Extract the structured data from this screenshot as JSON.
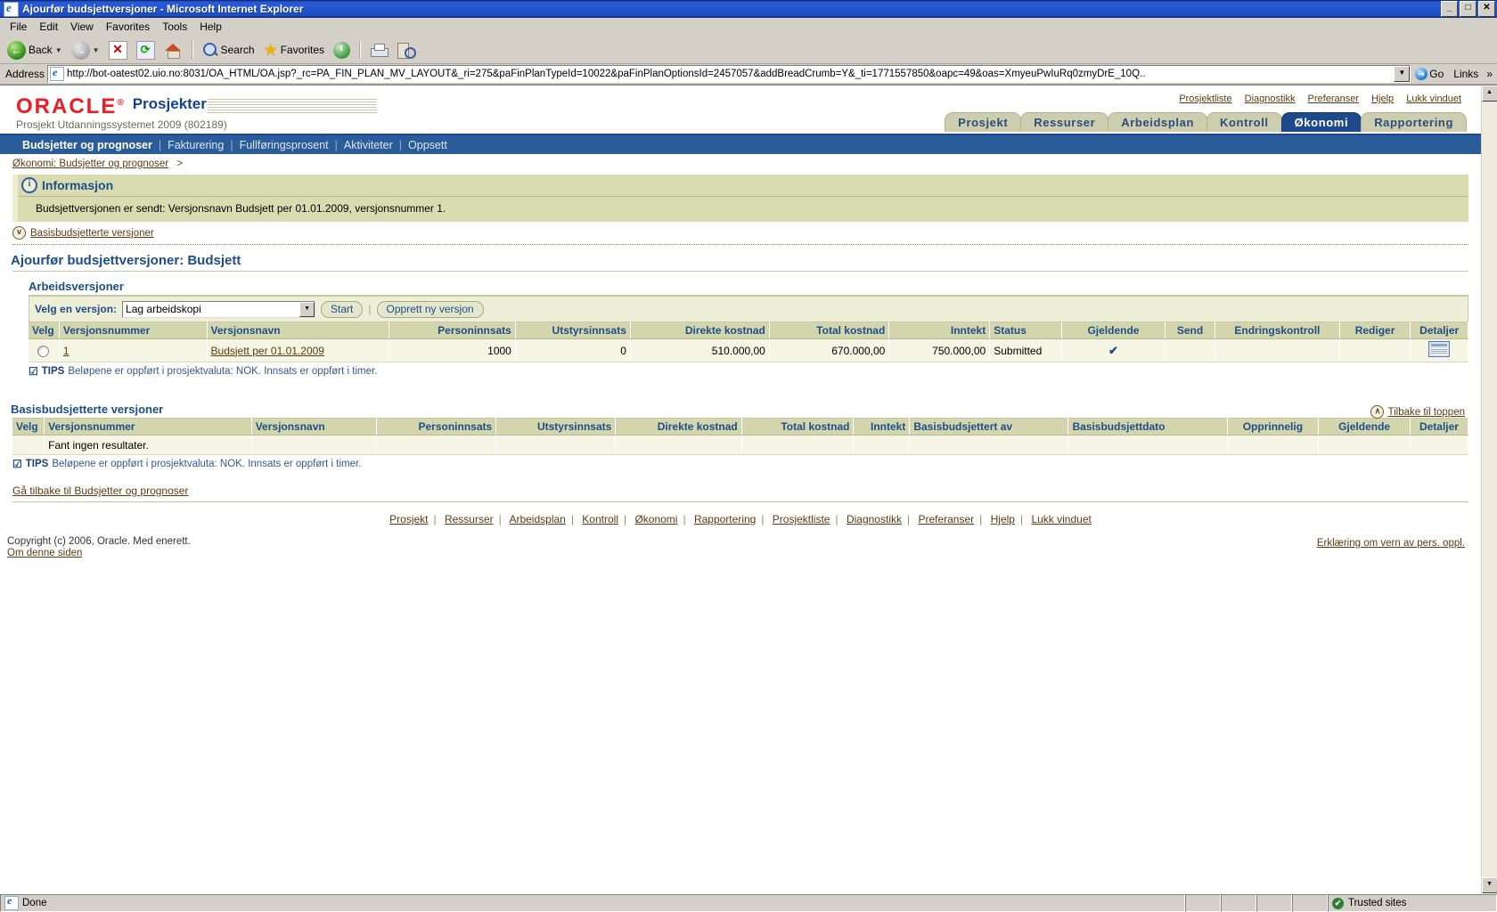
{
  "window": {
    "title": "Ajourfør budsjettversjoner - Microsoft Internet Explorer",
    "minimize": "_",
    "maximize": "□",
    "close": "✕"
  },
  "menu": {
    "items": [
      "File",
      "Edit",
      "View",
      "Favorites",
      "Tools",
      "Help"
    ]
  },
  "toolbar": {
    "back": "Back",
    "search": "Search",
    "favorites": "Favorites"
  },
  "address": {
    "label": "Address",
    "url": "http://bot-oatest02.uio.no:8031/OA_HTML/OA.jsp?_rc=PA_FIN_PLAN_MV_LAYOUT&_ri=275&paFinPlanTypeId=10022&paFinPlanOptionsId=2457057&addBreadCrumb=Y&_ti=1771557850&oapc=49&oas=XmyeuPwIuRq0zmyDrE_10Q..",
    "go": "Go",
    "links": "Links"
  },
  "branding": {
    "logo": "ORACLE",
    "product": "Prosjekter",
    "subtitle": "Prosjekt Utdanningssystemet 2009 (802189)"
  },
  "global_links": [
    "Prosjektliste",
    "Diagnostikk",
    "Preferanser",
    "Hjelp",
    "Lukk vinduet"
  ],
  "tabs": [
    {
      "label": "Prosjekt",
      "selected": false
    },
    {
      "label": "Ressurser",
      "selected": false
    },
    {
      "label": "Arbeidsplan",
      "selected": false
    },
    {
      "label": "Kontroll",
      "selected": false
    },
    {
      "label": "Økonomi",
      "selected": true
    },
    {
      "label": "Rapportering",
      "selected": false
    }
  ],
  "subnav": [
    {
      "label": "Budsjetter og prognoser",
      "selected": true
    },
    {
      "label": "Fakturering",
      "selected": false
    },
    {
      "label": "Fullføringsprosent",
      "selected": false
    },
    {
      "label": "Aktiviteter",
      "selected": false
    },
    {
      "label": "Oppsett",
      "selected": false
    }
  ],
  "breadcrumb": {
    "link": "Økonomi: Budsjetter og prognoser",
    "arrow": ">"
  },
  "information": {
    "title": "Informasjon",
    "message": "Budsjettversjonen er sendt: Versjonsnavn Budsjett per 01.01.2009, versjonsnummer 1."
  },
  "hide_show": {
    "label": "Basisbudsjetterte versjoner",
    "icon": "v"
  },
  "page_title": "Ajourfør budsjettversjoner: Budsjett",
  "working_versions": {
    "heading": "Arbeidsversjoner",
    "select_label": "Velg en versjon:",
    "select_value": "Lag arbeidskopi",
    "select_options": [
      "Lag arbeidskopi"
    ],
    "start_button": "Start",
    "create_button": "Opprett ny versjon",
    "columns": [
      "Velg",
      "Versjonsnummer",
      "Versjonsnavn",
      "Personinnsats",
      "Utstyrsinnsats",
      "Direkte kostnad",
      "Total kostnad",
      "Inntekt",
      "Status",
      "Gjeldende",
      "Send",
      "Endringskontroll",
      "Rediger",
      "Detaljer"
    ],
    "rows": [
      {
        "versjonsnummer": "1",
        "versjonsnavn": "Budsjett per 01.01.2009",
        "personinnsats": "1000",
        "utstyrsinnsats": "0",
        "direkte_kostnad": "510.000,00",
        "total_kostnad": "670.000,00",
        "inntekt": "750.000,00",
        "status": "Submitted",
        "gjeldende": "✔",
        "send": "",
        "endringskontroll": "",
        "rediger": "",
        "detaljer": "detaljer-icon"
      }
    ],
    "tips_label": "TIPS",
    "tips_text": "Beløpene er oppført i prosjektvaluta: NOK. Innsats er oppført i timer."
  },
  "baseline_versions": {
    "heading": "Basisbudsjetterte versjoner",
    "back_to_top": "Tilbake til toppen",
    "columns": [
      "Velg",
      "Versjonsnummer",
      "Versjonsnavn",
      "Personinnsats",
      "Utstyrsinnsats",
      "Direkte kostnad",
      "Total kostnad",
      "Inntekt",
      "Basisbudsjettert av",
      "Basisbudsjettdato",
      "Opprinnelig",
      "Gjeldende",
      "Detaljer"
    ],
    "empty_message": "Fant ingen resultater.",
    "tips_label": "TIPS",
    "tips_text": "Beløpene er oppført i prosjektvaluta: NOK. Innsats er oppført i timer."
  },
  "back_link": "Gå tilbake til Budsjetter og prognoser",
  "footer_links": [
    "Prosjekt",
    "Ressurser",
    "Arbeidsplan",
    "Kontroll",
    "Økonomi",
    "Rapportering",
    "Prosjektliste",
    "Diagnostikk",
    "Preferanser",
    "Hjelp",
    "Lukk vinduet"
  ],
  "copyright": "Copyright (c) 2006, Oracle. Med enerett.",
  "about_link": "Om denne siden",
  "privacy_link": "Erklæring om vern av pers. oppl.",
  "statusbar": {
    "done": "Done",
    "zone": "Trusted sites"
  },
  "colors": {
    "oracle_red": "#ed1c24",
    "header_blue": "#1d4e89",
    "tab_selected": "#1c4a8a",
    "link_brown": "#5b3c11",
    "table_header": "#d3d6ad",
    "table_cell": "#f4f5e4",
    "info_bg": "#d9dcb0"
  }
}
